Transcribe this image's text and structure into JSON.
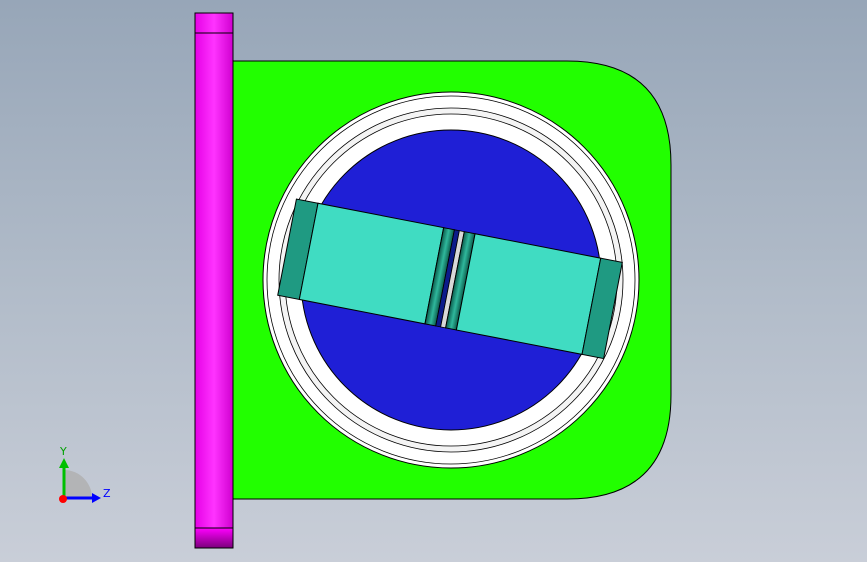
{
  "viewport": {
    "background_top": "#97a6b8",
    "background_bottom": "#c9ced8"
  },
  "colors": {
    "side_plate": "#ff00ff",
    "side_plate_shade": "#8c008c",
    "body": "#22ff00",
    "outer_ring": "#ffffff",
    "bore": "#1f1fd6",
    "block": "#40dcc2",
    "block_end": "#1f9a82",
    "slot_dark": "#0a4a3e",
    "slot_light": "#c0c0c0",
    "edge": "#000000"
  },
  "triad": {
    "y_label": "Y",
    "z_label": "Z",
    "y_color": "#00c000",
    "z_color": "#0000ff",
    "x_color": "#ff0000"
  }
}
